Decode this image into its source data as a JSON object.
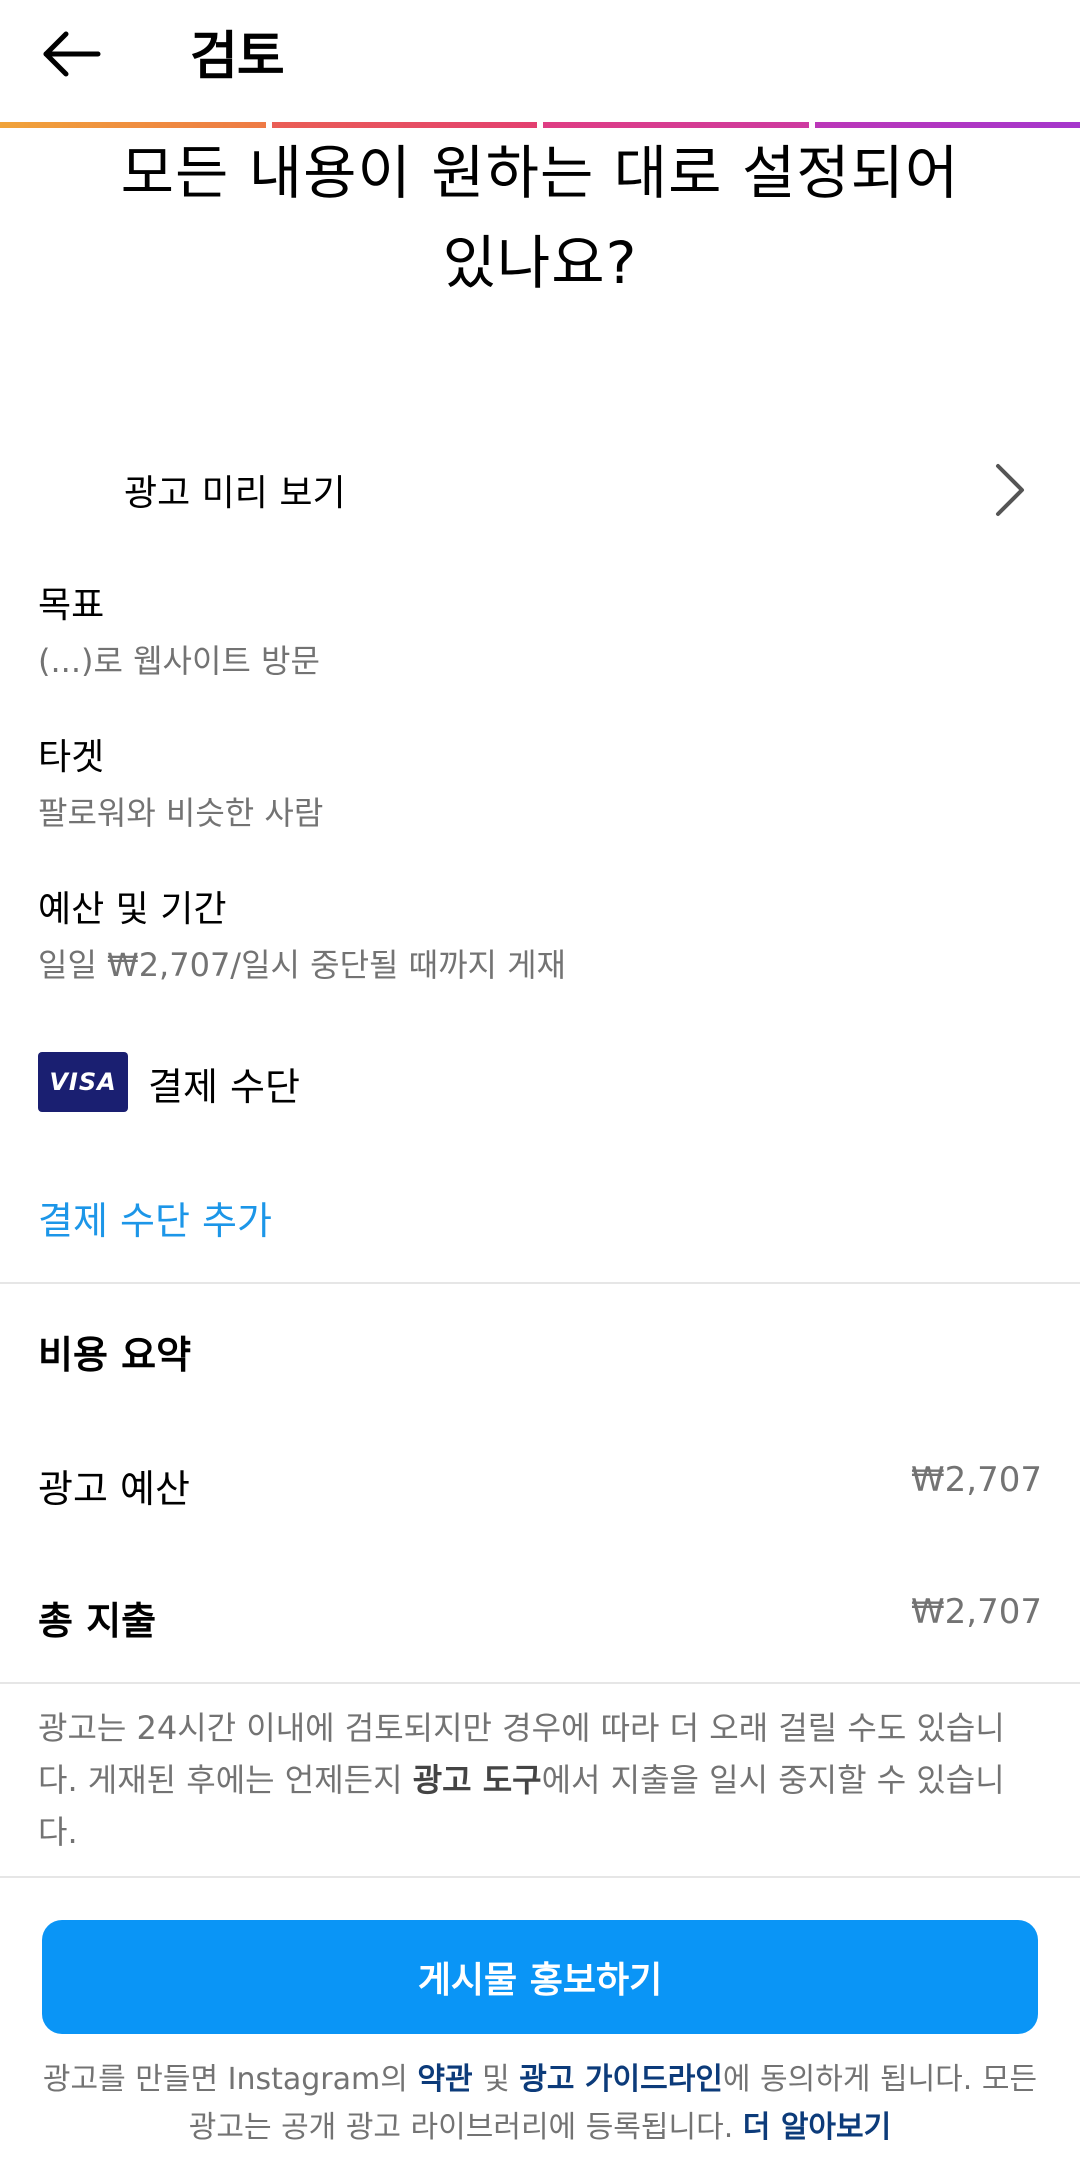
{
  "header": {
    "title": "검토"
  },
  "headline": {
    "line1": "모든 내용이 원하는 대로 설정되어",
    "line2": "있나요?"
  },
  "preview": {
    "label": "광고 미리 보기"
  },
  "goal": {
    "label": "목표",
    "value": "(...)로 웹사이트 방문"
  },
  "target": {
    "label": "타겟",
    "value": "팔로워와 비슷한 사람"
  },
  "budget": {
    "label": "예산 및 기간",
    "value": "일일 ₩2,707/일시 중단될 때까지 게재"
  },
  "payment": {
    "card_brand": "VISA",
    "label": "결제 수단",
    "add_label": "결제 수단 추가"
  },
  "summary": {
    "title": "비용 요약",
    "ad_budget_label": "광고 예산",
    "ad_budget_value": "₩2,707",
    "total_label": "총 지출",
    "total_value": "₩2,707"
  },
  "notice": {
    "part1": "광고는 24시간 이내에 검토되지만 경우에 따라 더 오래 걸릴 수도 있습니다. 게재된 후에는 언제든지 ",
    "bold": "광고 도구",
    "part2": "에서 지출을 일시 중지할 수 있습니다."
  },
  "cta": {
    "label": "게시물 홍보하기"
  },
  "terms": {
    "part1": "광고를 만들면 Instagram의 ",
    "link1": "약관",
    "part2": " 및 ",
    "link2": "광고 가이드라인",
    "part3": "에 동의하게 됩니다. 모든 광고는 공개 광고 라이브러리에 등록됩니다. ",
    "link3": "더 알아보기"
  },
  "colors": {
    "accent": "#0a95f6",
    "link": "#1c96e8",
    "visa": "#1a1f71"
  }
}
